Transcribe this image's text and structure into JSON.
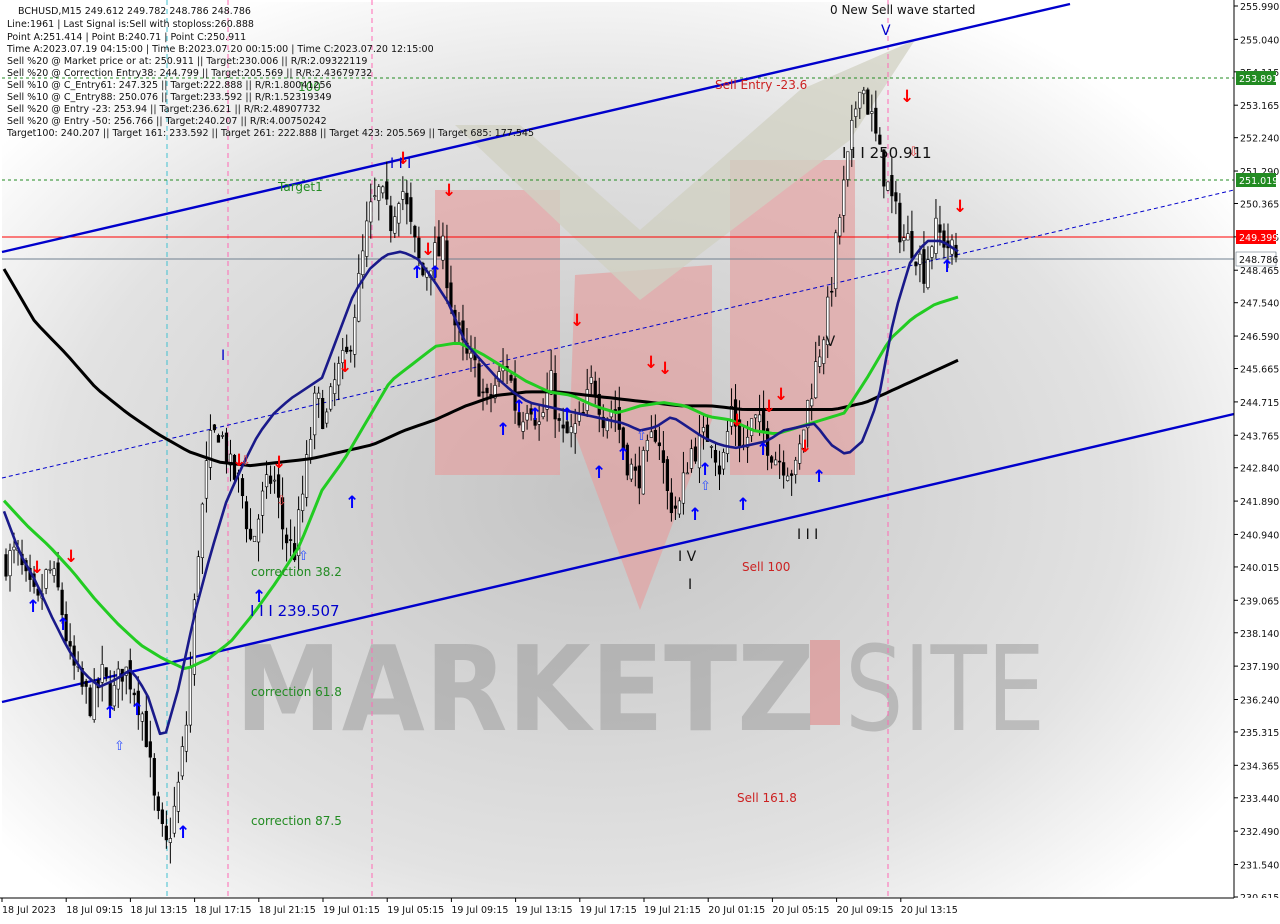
{
  "colors": {
    "bg_edge": "#ffffff",
    "bg_center": "#c6c6c6",
    "candle": "#000000",
    "ma_fast": "#1a1a8a",
    "ma_mid": "#22cc22",
    "ma_slow": "#000000",
    "channel": "#0000cc",
    "up_arrow": "#0000ff",
    "down_arrow": "#ff0000",
    "green_label": "#228b22",
    "red_label": "#cc2222",
    "price_red": "#ff0000",
    "price_green": "#228b22",
    "price_gray": "#506070",
    "vline_pink": "#ff69b4",
    "vline_cyan": "#40c0d0",
    "logo_red": "#e06060"
  },
  "info": [
    "BCHUSD,M15  249.612 249.782 248.786 248.786",
    "Line:1961 | Last Signal is:Sell with stoploss:260.888",
    "Point A:251.414 | Point B:240.71 | Point C:250.911",
    "Time A:2023.07.19 04:15:00 | Time B:2023.07.20 00:15:00 | Time C:2023.07.20 12:15:00",
    "Sell %20 @ Market price or at: 250.911 || Target:230.006 || R/R:2.09322119",
    "Sell %20 @ Correction Entry38: 244.799 || Target:205.569 || R/R:2.43679732",
    "Sell %10 @ C_Entry61: 247.325 || Target:222.888 || R/R:1.80041256",
    "Sell %10 @ C_Entry88: 250.076 || Target:233.592 || R/R:1.52319349",
    "Sell %20 @ Entry -23: 253.94 || Target:236.621 || R/R:2.48907732",
    "Sell %20 @ Entry -50: 256.766 || Target:240.207 || R/R:4.00750242",
    "Target100: 240.207 || Target 161: 233.592 || Target 261: 222.888 || Target 423: 205.569 || Target 685: 177.545"
  ],
  "top_banner": "0 New Sell wave started",
  "watermark": {
    "left": "MARKETZ",
    "right": "SITE"
  },
  "labels": {
    "sell_entry": "Sell Entry -23.6",
    "target1": "Target1",
    "hundred": "100",
    "point_c": "I I I 250.911",
    "iii_239": "I I I 239.507",
    "correction_382": "correction 38.2",
    "correction_618": "correction 61.8",
    "correction_875": "correction 87.5",
    "sell_100": "Sell 100",
    "sell_1618": "Sell 161.8",
    "iv_upper": "I V",
    "iv_lower": "I V",
    "i_mark": "I",
    "i_mark2": "I",
    "iii_mark": "I I I",
    "v_mark": "V"
  },
  "price_tags": [
    {
      "text": "253.891",
      "kind": "green"
    },
    {
      "text": "251.019",
      "kind": "green"
    },
    {
      "text": "249.399",
      "kind": "red"
    },
    {
      "text": "248.786",
      "kind": "gray"
    }
  ],
  "chart_data": {
    "type": "line",
    "symbol": "BCHUSD",
    "timeframe": "M15",
    "y_axis_ticks": [
      "255.990",
      "255.040",
      "254.115",
      "253.165",
      "252.240",
      "251.290",
      "250.365",
      "249.415",
      "248.465",
      "247.540",
      "246.590",
      "245.665",
      "244.715",
      "243.765",
      "242.840",
      "241.890",
      "240.940",
      "240.015",
      "239.065",
      "238.140",
      "237.190",
      "236.240",
      "235.315",
      "234.365",
      "233.440",
      "232.490",
      "231.540",
      "230.615"
    ],
    "x_axis_ticks": [
      "18 Jul 2023",
      "18 Jul 09:15",
      "18 Jul 13:15",
      "18 Jul 17:15",
      "18 Jul 21:15",
      "19 Jul 01:15",
      "19 Jul 05:15",
      "19 Jul 09:15",
      "19 Jul 13:15",
      "19 Jul 17:15",
      "19 Jul 21:15",
      "20 Jul 01:15",
      "20 Jul 05:15",
      "20 Jul 09:15",
      "20 Jul 13:15"
    ],
    "ylim": [
      230.615,
      255.99
    ],
    "horizontal_levels": [
      253.891,
      251.019,
      249.399,
      248.786
    ],
    "close_path": [
      240.2,
      240.4,
      239.4,
      238.9,
      240.0,
      239.2,
      237.4,
      236.6,
      236.1,
      236.9,
      236.3,
      237.2,
      236.6,
      235.6,
      233.0,
      232.0,
      233.4,
      235.8,
      240.5,
      243.4,
      244.0,
      242.8,
      242.3,
      240.6,
      241.9,
      242.7,
      241.0,
      240.4,
      242.5,
      244.8,
      244.2,
      245.5,
      246.0,
      248.0,
      250.0,
      250.7,
      249.8,
      251.0,
      249.5,
      248.3,
      248.9,
      249.0,
      247.0,
      246.0,
      245.6,
      244.6,
      245.3,
      245.8,
      244.1,
      244.9,
      244.0,
      245.3,
      243.7,
      243.8,
      244.2,
      245.4,
      244.3,
      244.6,
      243.2,
      242.5,
      243.1,
      244.1,
      242.0,
      241.6,
      243.3,
      243.5,
      243.9,
      242.7,
      244.6,
      243.3,
      244.2,
      243.8,
      243.2,
      243.0,
      242.7,
      244.5,
      245.9,
      247.3,
      249.8,
      251.8,
      254.0,
      252.9,
      251.5,
      250.4,
      249.4,
      249.2,
      248.5,
      249.6,
      249.3,
      248.8
    ],
    "ma_fast": [
      241.6,
      240.4,
      239.6,
      238.6,
      237.7,
      237.0,
      236.6,
      236.8,
      237.1,
      236.4,
      235.0,
      236.6,
      238.7,
      240.4,
      241.9,
      242.9,
      243.8,
      244.4,
      244.8,
      245.1,
      245.4,
      246.6,
      247.8,
      248.5,
      248.9,
      249.0,
      248.8,
      248.2,
      247.5,
      246.4,
      245.9,
      245.4,
      245.0,
      244.7,
      244.6,
      244.5,
      244.4,
      244.3,
      244.2,
      244.1,
      243.9,
      244.0,
      244.3,
      244.0,
      243.7,
      243.5,
      243.4,
      243.5,
      243.6,
      243.9,
      244.0,
      244.1,
      243.5,
      243.2,
      243.6,
      244.8,
      247.2,
      248.7,
      249.3,
      249.3,
      249.0
    ],
    "ma_mid": [
      241.9,
      241.2,
      240.6,
      239.9,
      239.1,
      238.4,
      237.8,
      237.4,
      237.1,
      237.4,
      237.9,
      238.7,
      239.6,
      240.6,
      242.2,
      243.1,
      244.2,
      245.3,
      245.8,
      246.3,
      246.4,
      246.1,
      245.7,
      245.3,
      245.0,
      244.9,
      244.6,
      244.4,
      244.6,
      244.7,
      244.6,
      244.3,
      244.2,
      243.9,
      243.8,
      244.0,
      244.2,
      244.4,
      245.4,
      246.5,
      247.1,
      247.5,
      247.7
    ],
    "ma_slow": [
      248.5,
      247.0,
      246.1,
      245.1,
      244.4,
      243.8,
      243.3,
      243.0,
      242.9,
      243.0,
      243.1,
      243.3,
      243.5,
      243.9,
      244.2,
      244.6,
      244.9,
      245.0,
      245.0,
      244.9,
      244.8,
      244.7,
      244.6,
      244.6,
      244.5,
      244.5,
      244.5,
      244.5,
      244.7,
      245.1,
      245.5,
      245.9
    ],
    "ma_fast_name": "",
    "ma_mid_name": "",
    "ma_slow_name": ""
  }
}
